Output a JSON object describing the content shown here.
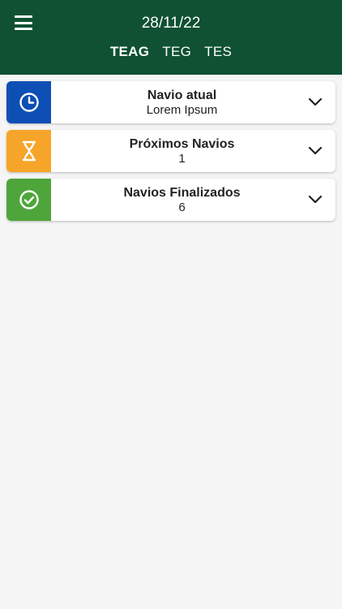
{
  "header": {
    "date": "28/11/22",
    "tabs": [
      {
        "label": "TEAG",
        "active": true
      },
      {
        "label": "TEG",
        "active": false
      },
      {
        "label": "TES",
        "active": false
      }
    ],
    "background": "#0f5132"
  },
  "cards": [
    {
      "title": "Navio atual",
      "subtitle": "Lorem Ipsum",
      "icon": "clock-icon",
      "color": "#0d4fb5"
    },
    {
      "title": "Próximos Navios",
      "subtitle": "1",
      "icon": "hourglass-icon",
      "color": "#f6a52a"
    },
    {
      "title": "Navios Finalizados",
      "subtitle": "6",
      "icon": "check-circle-icon",
      "color": "#4ea63b"
    }
  ]
}
